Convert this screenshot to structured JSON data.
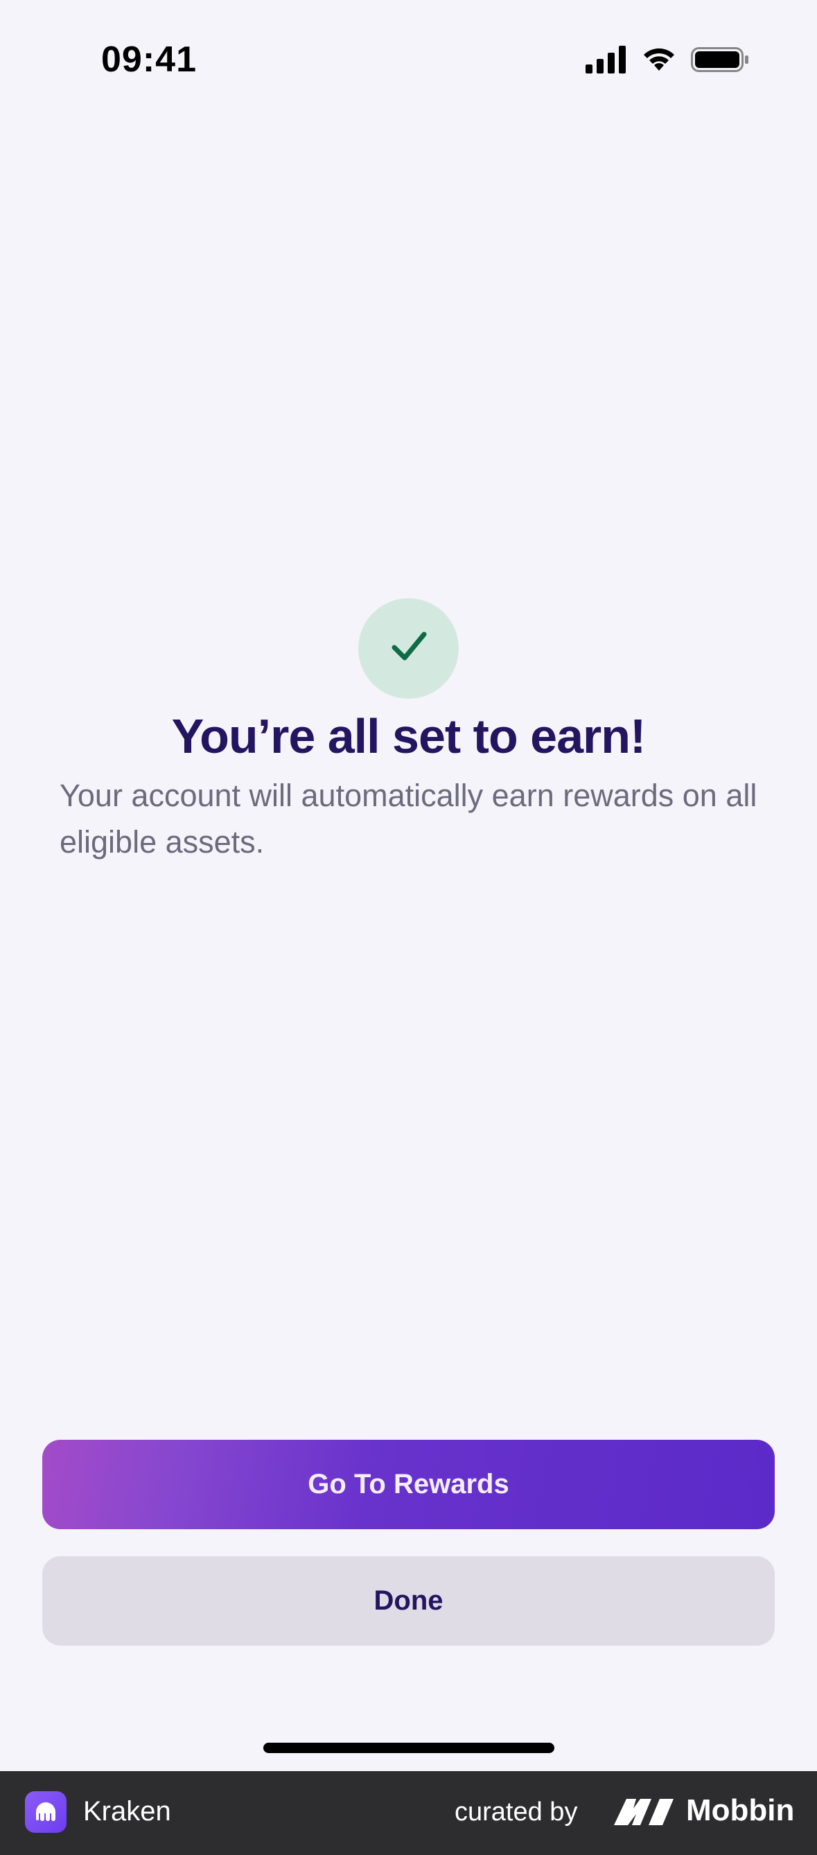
{
  "status_bar": {
    "time": "09:41",
    "icons": [
      "cellular-signal-icon",
      "wifi-icon",
      "battery-icon"
    ]
  },
  "success": {
    "icon": "checkmark-icon",
    "title": "You’re all set to earn!",
    "subtitle": "Your account will automatically earn rewards on all eligible assets."
  },
  "actions": {
    "primary_label": "Go To Rewards",
    "secondary_label": "Done"
  },
  "footer": {
    "app_name": "Kraken",
    "curated_label": "curated by",
    "brand_name": "Mobbin"
  },
  "colors": {
    "background": "#f5f4fa",
    "title": "#241560",
    "success_circle": "#d3e9df",
    "success_check": "#0f6b45",
    "primary_button": "#5b2ac8",
    "secondary_button": "#dfdce6",
    "footer": "#2d2d2f"
  }
}
